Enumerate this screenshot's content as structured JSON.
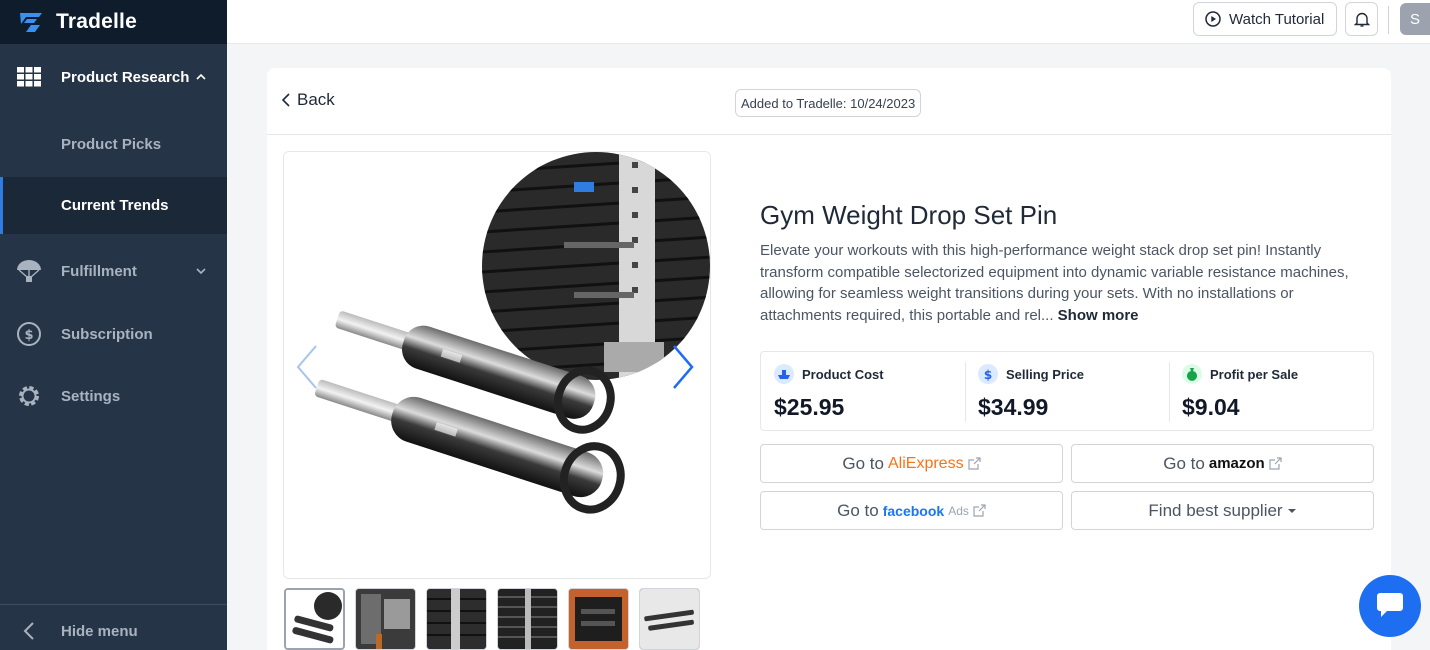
{
  "app": {
    "name": "Tradelle"
  },
  "sidebar": {
    "product_research": "Product Research",
    "product_picks": "Product Picks",
    "current_trends": "Current Trends",
    "fulfillment": "Fulfillment",
    "subscription": "Subscription",
    "settings": "Settings",
    "hide_menu": "Hide menu"
  },
  "topbar": {
    "watch_tutorial": "Watch Tutorial",
    "avatar_initial": "S"
  },
  "product": {
    "back_label": "Back",
    "added_badge": "Added to Tradelle: 10/24/2023",
    "title": "Gym Weight Drop Set Pin",
    "description": "Elevate your workouts with this high-performance weight stack drop set pin! Instantly transform compatible selectorized equipment into dynamic variable resistance machines, allowing for seamless weight transitions during your sets. With no installations or attachments required, this portable and rel...",
    "show_more": "Show more",
    "stats": {
      "product_cost_label": "Product Cost",
      "product_cost": "$25.95",
      "selling_price_label": "Selling Price",
      "selling_price": "$34.99",
      "profit_label": "Profit per Sale",
      "profit": "$9.04"
    },
    "links": {
      "go_to": "Go to",
      "aliexpress": "AliExpress",
      "amazon": "amazon",
      "facebook": "facebook",
      "ads": "Ads",
      "find_supplier": "Find best supplier"
    },
    "thumbnail_count": 6
  },
  "colors": {
    "sidebar_bg": "#253446",
    "brand_bg": "#0f1c2b",
    "accent_blue": "#1e6ef2",
    "aliexpress_orange": "#f97316",
    "facebook_blue": "#1877f2"
  }
}
